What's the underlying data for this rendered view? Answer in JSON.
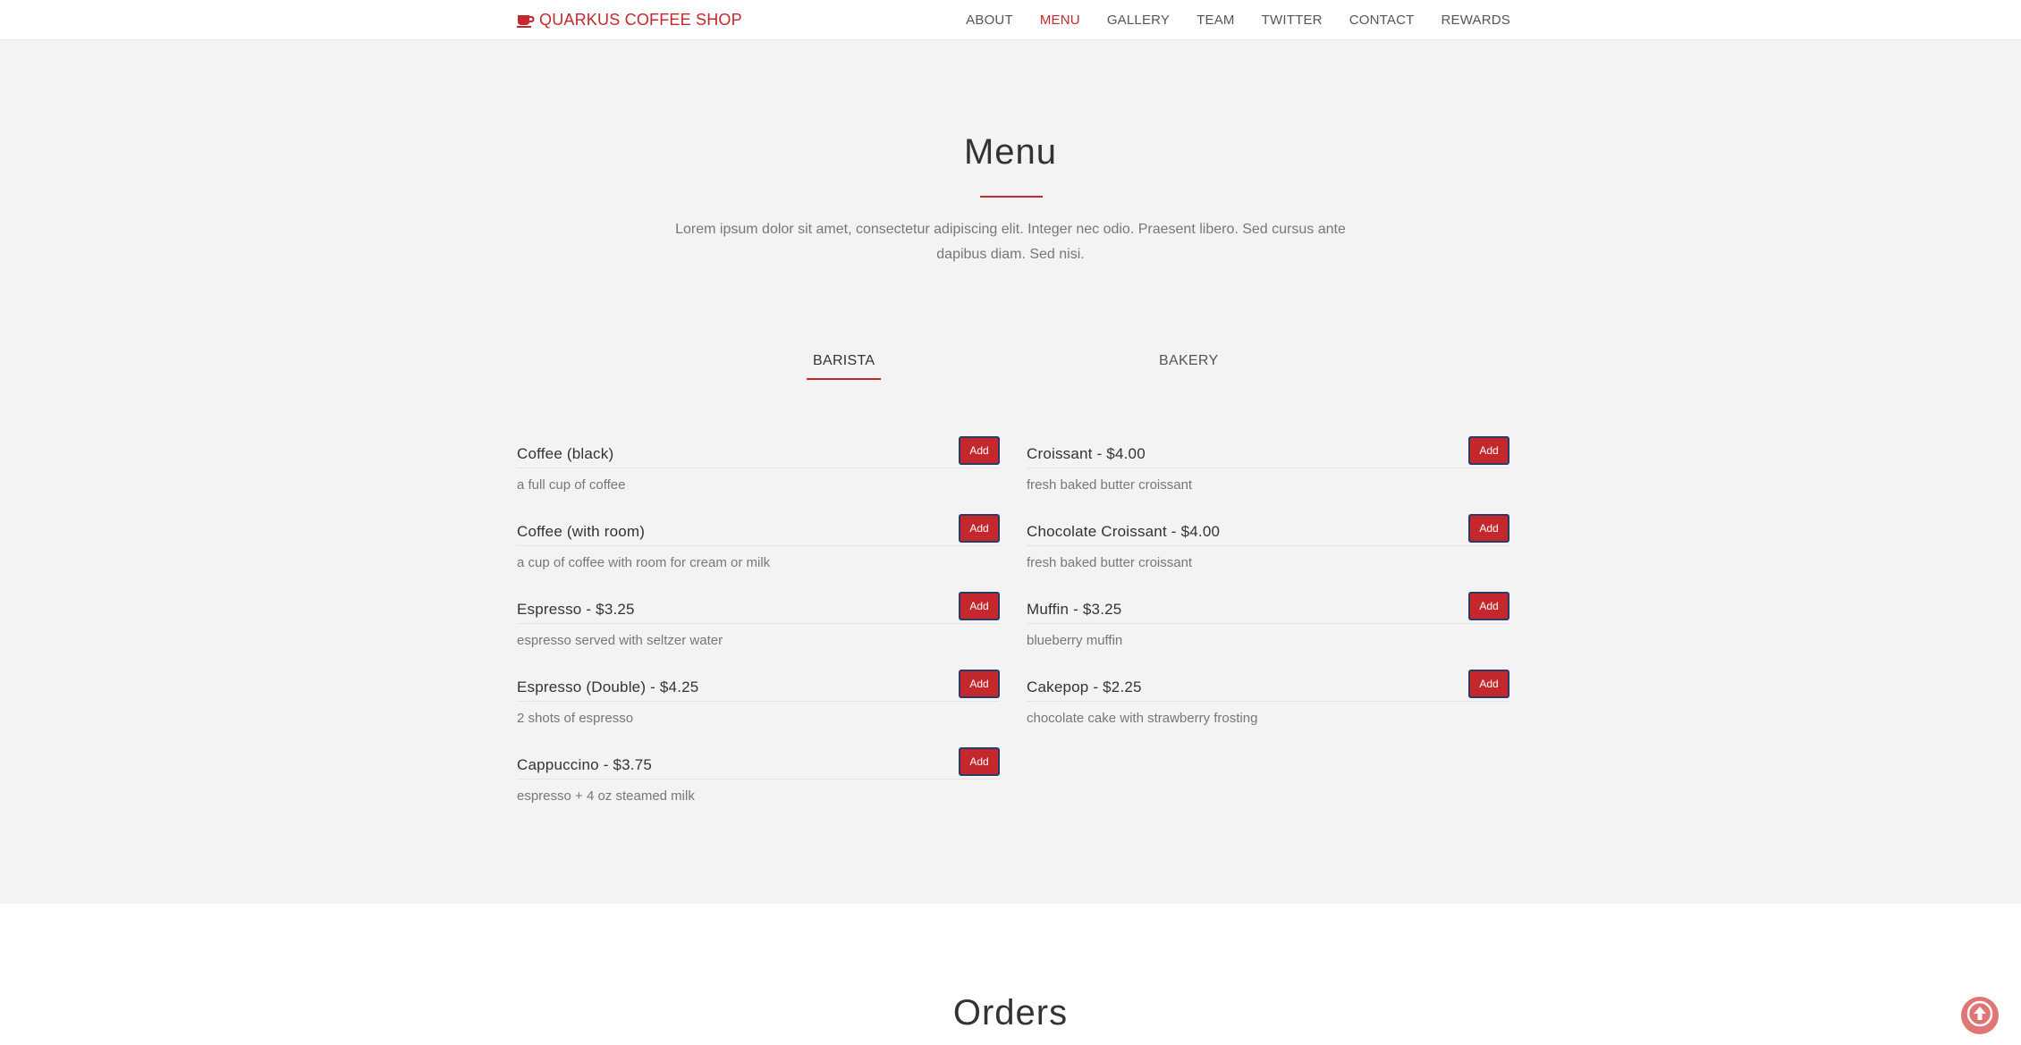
{
  "brand": {
    "name": "QUARKUS COFFEE SHOP",
    "icon": "coffee-cup-icon"
  },
  "nav": {
    "items": [
      {
        "label": "ABOUT"
      },
      {
        "label": "MENU",
        "active": true
      },
      {
        "label": "GALLERY"
      },
      {
        "label": "TEAM"
      },
      {
        "label": "TWITTER"
      },
      {
        "label": "CONTACT"
      },
      {
        "label": "REWARDS"
      }
    ]
  },
  "menu": {
    "title": "Menu",
    "intro": "Lorem ipsum dolor sit amet, consectetur adipiscing elit. Integer nec odio. Praesent libero. Sed cursus ante dapibus diam. Sed nisi.",
    "tabs": [
      {
        "label": "BARISTA",
        "active": true
      },
      {
        "label": "BAKERY"
      }
    ],
    "add_label": "Add",
    "barista": [
      {
        "name": "Coffee (black)",
        "desc": "a full cup of coffee"
      },
      {
        "name": "Coffee (with room)",
        "desc": "a cup of coffee with room for cream or milk"
      },
      {
        "name": "Espresso - $3.25",
        "desc": "espresso served with seltzer water"
      },
      {
        "name": "Espresso (Double) - $4.25",
        "desc": "2 shots of espresso"
      },
      {
        "name": "Cappuccino - $3.75",
        "desc": "espresso + 4 oz steamed milk"
      }
    ],
    "bakery": [
      {
        "name": "Croissant - $4.00",
        "desc": "fresh baked butter croissant"
      },
      {
        "name": "Chocolate Croissant - $4.00",
        "desc": "fresh baked butter croissant"
      },
      {
        "name": "Muffin - $3.25",
        "desc": "blueberry muffin"
      },
      {
        "name": "Cakepop - $2.25",
        "desc": "chocolate cake with strawberry frosting"
      }
    ]
  },
  "orders": {
    "title": "Orders"
  },
  "scroll_top": {
    "icon": "arrow-up-circle-icon"
  },
  "colors": {
    "accent": "#c5282c",
    "button_border": "#2b3a67",
    "section_bg": "#f3f3f3",
    "scroll_top_bg": "#e07575"
  }
}
